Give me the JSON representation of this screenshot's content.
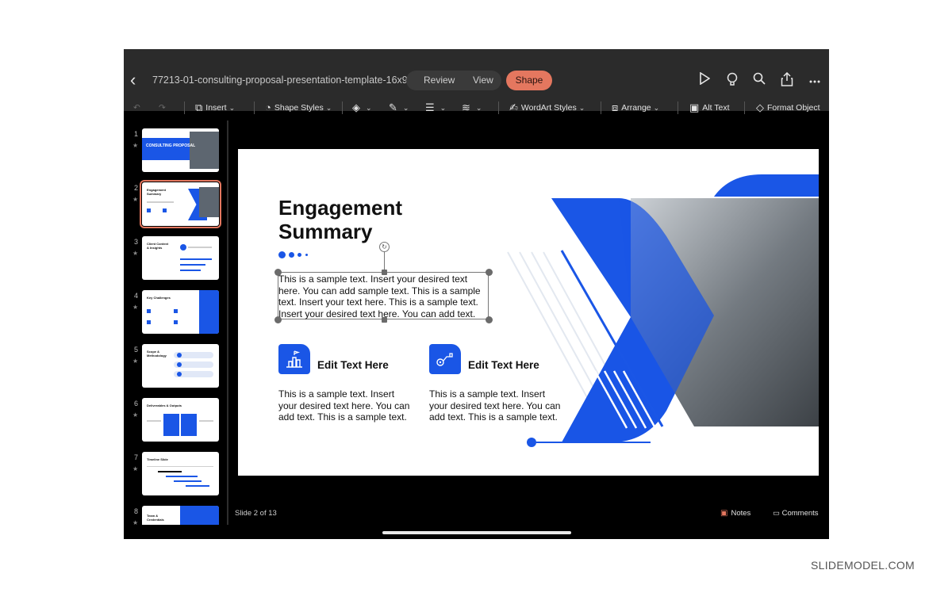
{
  "window": {
    "doc_title": "77213-01-consulting-proposal-presentation-template-16x9",
    "tabs": [
      {
        "label": "Review"
      },
      {
        "label": "View"
      }
    ],
    "active_tab": {
      "label": "Shape",
      "color": "#e4775f"
    }
  },
  "top_icons": [
    "play-icon",
    "lightbulb-icon",
    "search-icon",
    "share-icon",
    "more-icon"
  ],
  "ribbon": {
    "insert": "Insert",
    "shape_styles": "Shape Styles",
    "wordart_styles": "WordArt Styles",
    "arrange": "Arrange",
    "alt_text": "Alt Text",
    "format_object": "Format Object"
  },
  "thumbnails": [
    {
      "num": "1",
      "title": "CONSULTING PROPOSAL"
    },
    {
      "num": "2",
      "title": "Engagement Summary",
      "selected": true
    },
    {
      "num": "3",
      "title": "Client Context & Insights"
    },
    {
      "num": "4",
      "title": "Key Challenges"
    },
    {
      "num": "5",
      "title": "Scope & Methodology"
    },
    {
      "num": "6",
      "title": "Deliverables & Outputs"
    },
    {
      "num": "7",
      "title": "Timeline Slide"
    },
    {
      "num": "8",
      "title": "Team & Credentials"
    }
  ],
  "slide": {
    "title_line1": "Engagement",
    "title_line2": "Summary",
    "selected_text": "This is a sample text. Insert your desired text here. You can add sample text. This is a sample text. Insert your text here. This is a sample text. Insert your desired text here. You can add text.",
    "features": [
      {
        "heading": "Edit Text Here",
        "body": "This is a sample text. Insert your desired text here. You can add text. This is a sample text.",
        "icon": "podium-icon"
      },
      {
        "heading": "Edit Text Here",
        "body": "This is a sample text. Insert your desired text here. You can add text. This is a sample text.",
        "icon": "route-icon"
      }
    ],
    "accent_color": "#1a56e6"
  },
  "status": {
    "slide_count": "Slide 2 of 13",
    "notes": "Notes",
    "comments": "Comments"
  },
  "watermark": "SLIDEMODEL.COM"
}
